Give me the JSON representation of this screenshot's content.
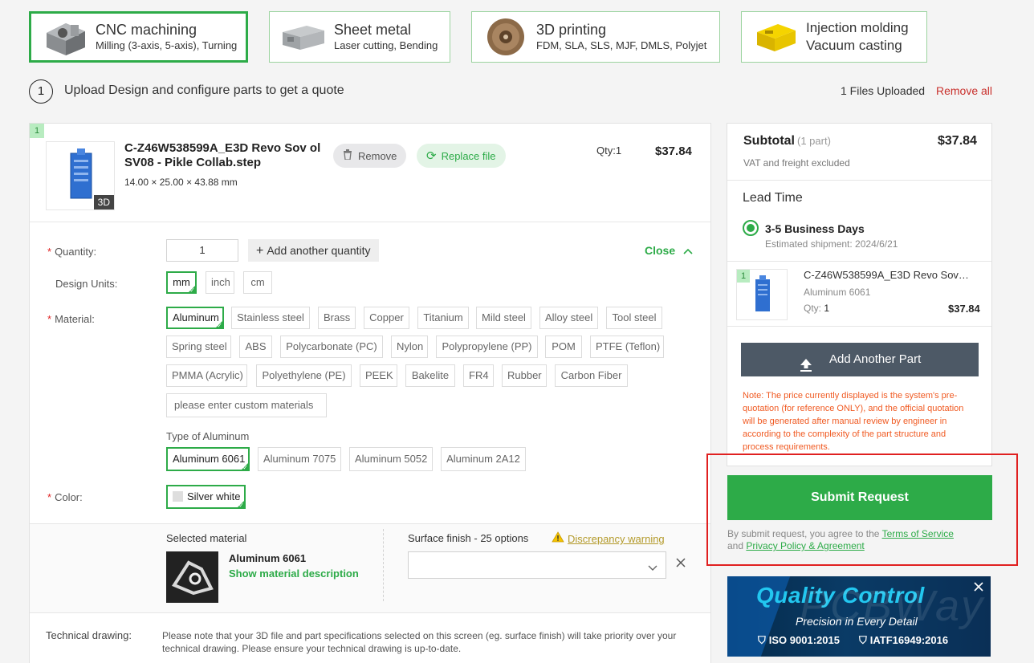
{
  "process_tabs": [
    {
      "title": "CNC machining",
      "subtitle": "Milling (3-axis, 5-axis), Turning",
      "active": true
    },
    {
      "title": "Sheet metal",
      "subtitle": "Laser cutting, Bending",
      "active": false
    },
    {
      "title": "3D printing",
      "subtitle": "FDM, SLA, SLS, MJF, DMLS, Polyjet",
      "active": false
    },
    {
      "title": "Injection molding",
      "subtitle": "Vacuum casting",
      "active": false
    }
  ],
  "step": {
    "number": "1",
    "text": "Upload Design and configure parts to get a quote"
  },
  "files_uploaded": "1 Files Uploaded",
  "remove_all": "Remove all",
  "part": {
    "index": "1",
    "badge": "3D",
    "name": "C-Z46W538599A_E3D Revo Sov ol SV08 - Pikle Collab.step",
    "dimensions": "14.00 × 25.00 × 43.88 mm",
    "remove_label": "Remove",
    "replace_label": "Replace file",
    "qty": "Qty:1",
    "price": "$37.84"
  },
  "config": {
    "quantity_label": "Quantity:",
    "quantity_value": "1",
    "add_quantity": "Add another quantity",
    "close_label": "Close",
    "units_label": "Design Units:",
    "units": [
      "mm",
      "inch",
      "cm"
    ],
    "material_label": "Material:",
    "materials": [
      "Aluminum",
      "Stainless steel",
      "Brass",
      "Copper",
      "Titanium",
      "Mild steel",
      "Alloy steel",
      "Tool steel",
      "Spring steel",
      "ABS",
      "Polycarbonate (PC)",
      "Nylon",
      "Polypropylene (PP)",
      "POM",
      "PTFE (Teflon)",
      "PMMA (Acrylic)",
      "Polyethylene (PE)",
      "PEEK",
      "Bakelite",
      "FR4",
      "Rubber",
      "Carbon Fiber"
    ],
    "custom_material_placeholder": "please enter custom materials",
    "type_label": "Type of Aluminum",
    "types": [
      "Aluminum 6061",
      "Aluminum 7075",
      "Aluminum 5052",
      "Aluminum 2A12"
    ],
    "color_label": "Color:",
    "color_value": "Silver white"
  },
  "selected_material": {
    "heading": "Selected material",
    "name": "Aluminum 6061",
    "link": "Show material description"
  },
  "surface": {
    "label": "Surface finish - 25 options",
    "warning": "Discrepancy warning",
    "value": ""
  },
  "technical": {
    "label": "Technical drawing:",
    "note": "Please note that your 3D file and part specifications selected on this screen (eg. surface finish) will take priority over your technical drawing. Please ensure your technical drawing is up-to-date."
  },
  "summary": {
    "subtotal_label": "Subtotal",
    "parts_count": "(1 part)",
    "subtotal": "$37.84",
    "vat_note": "VAT and freight excluded",
    "lead_time_label": "Lead Time",
    "lead_option": "3-5 Business Days",
    "shipment": "Estimated shipment: 2024/6/21",
    "item_index": "1",
    "item_name": "C-Z46W538599A_E3D Revo Sov…",
    "item_material": "Aluminum 6061",
    "item_qty_label": "Qty:",
    "item_qty": "1",
    "item_price": "$37.84",
    "add_part": "Add Another Part",
    "note": "Note: The price currently displayed is the system's pre-quotation (for reference ONLY), and the official quotation will be generated after manual review by engineer in according to the complexity of the part structure and process requirements."
  },
  "submit": {
    "label": "Submit Request",
    "agree_prefix": "By submit request, you agree to the ",
    "terms": "Terms of Service",
    "and": "and ",
    "privacy": "Privacy Policy & Agreement"
  },
  "banner": {
    "title": "Quality Control",
    "subtitle": "Precision in Every Detail",
    "cert1": "ISO 9001:2015",
    "cert2": "IATF16949:2016",
    "watermark": "PCBWay"
  },
  "colors": {
    "accent": "#2dab48",
    "danger": "#e02020",
    "dark_button": "#4d5966"
  }
}
